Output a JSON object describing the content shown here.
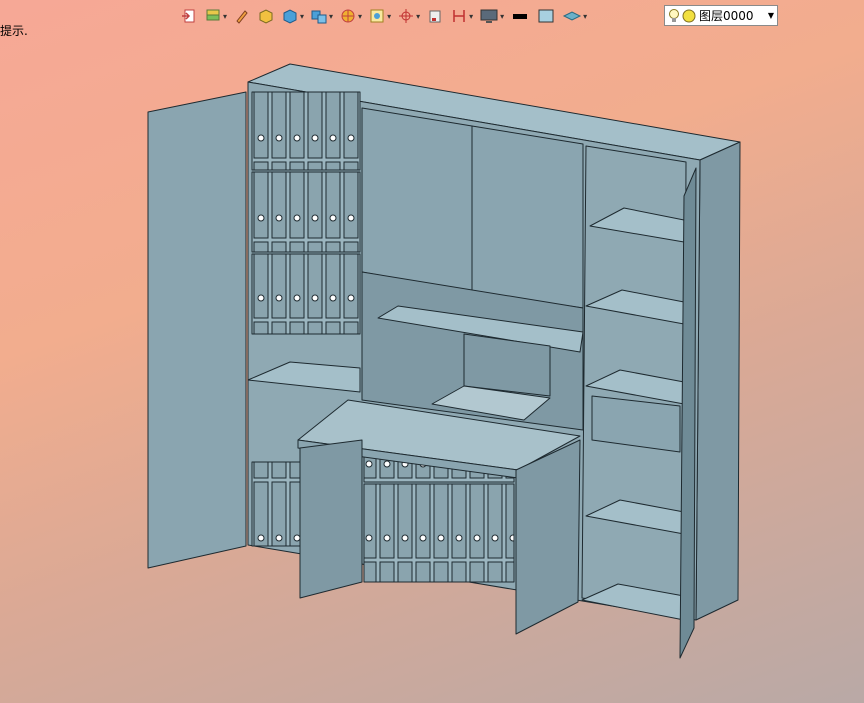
{
  "hint_text": "提示.",
  "layer_selector": {
    "value": "图层0000",
    "icons": [
      "lightbulb-icon",
      "yellow-circle-icon"
    ]
  },
  "toolbar_icons": [
    "import-icon",
    "layers-stack-icon",
    "pencil-icon",
    "box-orange-icon",
    "cube-blue-icon",
    "cube-group-icon",
    "sphere-render-icon",
    "frame-select-icon",
    "axis-red-icon",
    "small-square-icon",
    "measure-red-icon",
    "monitor-icon",
    "color-black-icon",
    "color-lightblue-icon",
    "plane-layer-icon"
  ],
  "colors": {
    "background_top": "#f6a896",
    "background_bottom": "#b9a9a6",
    "model_face_front": "#8fa9b3",
    "model_face_light": "#a4bfc9",
    "model_face_dark": "#6f8b96",
    "edge": "#1e2a30"
  }
}
